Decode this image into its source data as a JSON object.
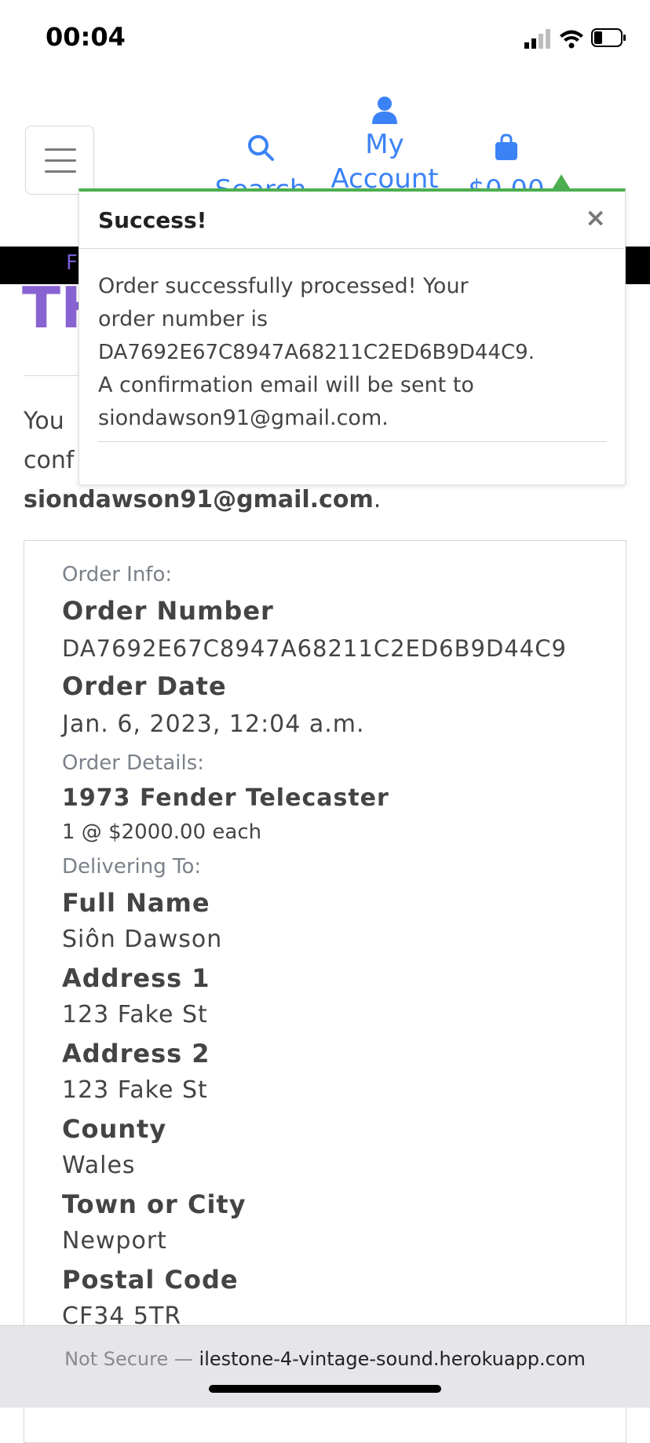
{
  "status_bar": {
    "time": "00:04",
    "icons": [
      "signal-icon",
      "wifi-icon",
      "battery-icon"
    ]
  },
  "header": {
    "nav": {
      "search_label": "Search",
      "account_label": "My Account",
      "bag_total": "$0.00"
    }
  },
  "banner": {
    "text": "F"
  },
  "page": {
    "title": "TH",
    "intro_line1": "You",
    "intro_line2": "conf",
    "intro_email": "siondawson91@gmail.com",
    "intro_period": "."
  },
  "toast": {
    "title": "Success!",
    "close": "×",
    "message_line1": "Order successfully processed! Your",
    "message_line2": "order number is",
    "message_line3": "DA7692E67C8947A68211C2ED6B9D44C9.",
    "message_line4": "A confirmation email will be sent to",
    "message_line5": "siondawson91@gmail.com."
  },
  "order": {
    "order_info_label": "Order Info:",
    "order_number_label": "Order Number",
    "order_number": "DA7692E67C8947A68211C2ED6B9D44C9",
    "order_date_label": "Order Date",
    "order_date": "Jan. 6, 2023, 12:04 a.m.",
    "order_details_label": "Order Details:",
    "item_name": "1973 Fender Telecaster",
    "item_qty_price": "1 @ $2000.00 each",
    "delivering_label": "Delivering To:",
    "full_name_label": "Full Name",
    "full_name": "Siôn Dawson",
    "address1_label": "Address 1",
    "address1": "123 Fake St",
    "address2_label": "Address 2",
    "address2": "123 Fake St",
    "county_label": "County",
    "county": "Wales",
    "town_label": "Town or City",
    "town": "Newport",
    "postal_label": "Postal Code",
    "postal": "CF34 5TR"
  },
  "browser": {
    "not_secure": "Not Secure —",
    "url": "ilestone-4-vintage-sound.herokuapp.com"
  },
  "colors": {
    "accent_blue": "#3b82f6",
    "title_purple": "#8a63d2",
    "success_green": "#4caf50"
  }
}
